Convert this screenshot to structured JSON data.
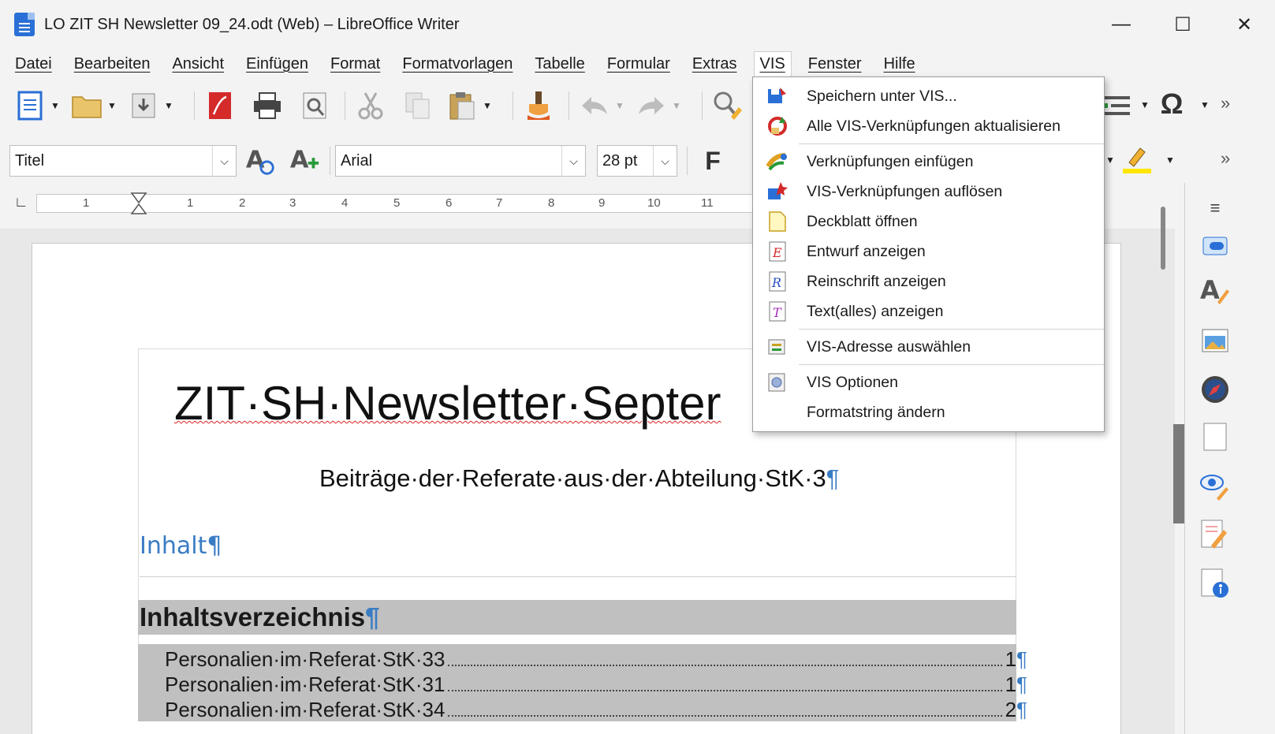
{
  "window": {
    "title": "LO ZIT SH Newsletter 09_24.odt (Web) – LibreOffice Writer",
    "minimize": "—",
    "maximize": "☐",
    "close": "✕"
  },
  "menubar": [
    "Datei",
    "Bearbeiten",
    "Ansicht",
    "Einfügen",
    "Format",
    "Formatvorlagen",
    "Tabelle",
    "Formular",
    "Extras",
    "VIS",
    "Fenster",
    "Hilfe"
  ],
  "active_menu": "VIS",
  "formatting": {
    "paragraph_style": "Titel",
    "font_name": "Arial",
    "font_size": "28 pt",
    "bold": "F"
  },
  "ruler": {
    "numbers": [
      "1",
      "1",
      "2",
      "3",
      "4",
      "5",
      "6",
      "7",
      "8",
      "9",
      "10",
      "11"
    ]
  },
  "document": {
    "title": "ZIT·SH·Newsletter·Septer",
    "subtitle": "Beiträge·der·Referate·aus·der·Abteilung·StK·3",
    "inhalt": "Inhalt",
    "toc_heading": "Inhaltsverzeichnis",
    "pilcrow": "¶",
    "toc_entries": [
      {
        "text": "Personalien·im·Referat·StK·33",
        "page": "1"
      },
      {
        "text": "Personalien·im·Referat·StK·31",
        "page": "1"
      },
      {
        "text": "Personalien·im·Referat·StK·34",
        "page": "2"
      }
    ]
  },
  "vis_menu": {
    "items": [
      {
        "label": "Speichern unter VIS...",
        "icon": "save-vis-icon"
      },
      {
        "label": "Alle VIS-Verknüpfungen aktualisieren",
        "icon": "refresh-links-icon"
      },
      {
        "label": "Verknüpfungen einfügen",
        "icon": "insert-links-icon"
      },
      {
        "label": "VIS-Verknüpfungen auflösen",
        "icon": "dissolve-links-icon"
      },
      {
        "label": "Deckblatt öffnen",
        "icon": "cover-page-icon"
      },
      {
        "label": "Entwurf anzeigen",
        "icon": "draft-icon"
      },
      {
        "label": "Reinschrift anzeigen",
        "icon": "fair-copy-icon"
      },
      {
        "label": "Text(alles) anzeigen",
        "icon": "text-all-icon"
      },
      {
        "label": "VIS-Adresse auswählen",
        "icon": "address-icon"
      },
      {
        "label": "VIS Optionen",
        "icon": "options-icon"
      },
      {
        "label": "Formatstring ändern",
        "icon": ""
      }
    ]
  },
  "colors": {
    "accent_blue": "#3a7cc4",
    "toc_gray": "#c0c0c0",
    "highlight_yellow": "#ffe600"
  }
}
